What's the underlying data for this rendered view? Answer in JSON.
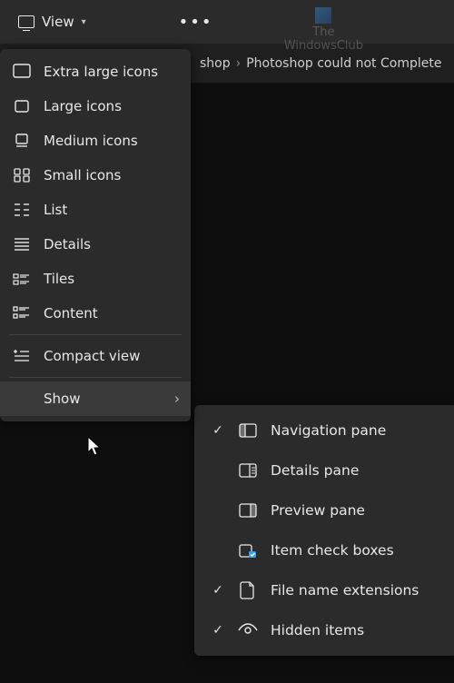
{
  "toolbar": {
    "view_label": "View"
  },
  "watermark": {
    "line1": "The",
    "line2": "WindowsClub"
  },
  "breadcrumb": {
    "frag1": "shop",
    "frag2": "Photoshop could not Complete"
  },
  "view_menu": {
    "items": [
      {
        "label": "Extra large icons"
      },
      {
        "label": "Large icons"
      },
      {
        "label": "Medium icons"
      },
      {
        "label": "Small icons"
      },
      {
        "label": "List"
      },
      {
        "label": "Details"
      },
      {
        "label": "Tiles"
      },
      {
        "label": "Content"
      }
    ],
    "compact_label": "Compact view",
    "show_label": "Show"
  },
  "show_menu": {
    "items": [
      {
        "checked": true,
        "label": "Navigation pane"
      },
      {
        "checked": false,
        "label": "Details pane"
      },
      {
        "checked": false,
        "label": "Preview pane"
      },
      {
        "checked": false,
        "label": "Item check boxes"
      },
      {
        "checked": true,
        "label": "File name extensions"
      },
      {
        "checked": true,
        "label": "Hidden items"
      }
    ]
  }
}
